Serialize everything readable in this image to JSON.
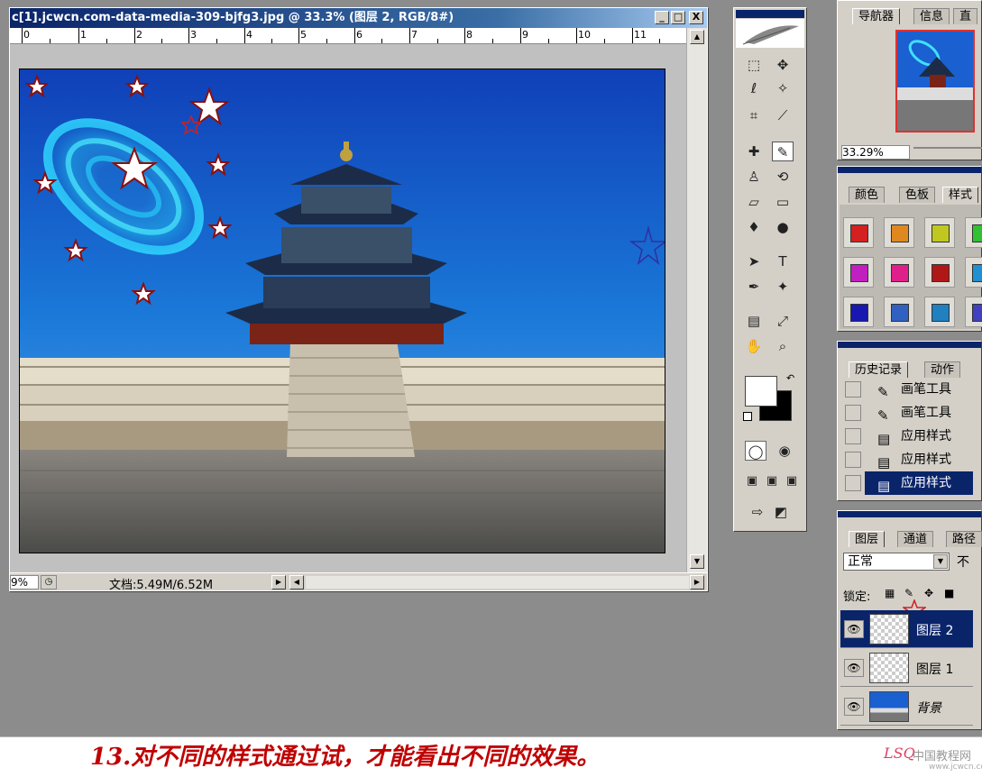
{
  "window": {
    "title": "c[1].jcwcn.com-data-media-309-bjfg3.jpg @ 33.3% (图层 2, RGB/8#)",
    "btn_min": "_",
    "btn_max": "□",
    "btn_close": "X"
  },
  "ruler": {
    "labels": [
      "0",
      "1",
      "2",
      "3",
      "4",
      "5",
      "6",
      "7",
      "8",
      "9",
      "10",
      "11"
    ]
  },
  "status": {
    "zoom": "9%",
    "doc": "文档:5.49M/6.52M",
    "arrow": "▶"
  },
  "navigator": {
    "tabs": [
      "导航器",
      "信息",
      "直"
    ],
    "zoom": "33.29%"
  },
  "swatches": {
    "tabs": [
      "颜色",
      "色板",
      "样式"
    ],
    "colors": [
      "#d42020",
      "#e08820",
      "#c0c820",
      "#30c030",
      "#c020c0",
      "#e0208a",
      "#b01818",
      "#2090d0",
      "#1818b0",
      "#3060c0",
      "#2080c0",
      "#4040c0"
    ]
  },
  "history": {
    "tabs": [
      "历史记录",
      "动作"
    ],
    "items": [
      "画笔工具",
      "画笔工具",
      "应用样式",
      "应用样式",
      "应用样式"
    ],
    "icons": [
      "brush-icon",
      "brush-icon",
      "document-icon",
      "document-icon",
      "document-icon"
    ]
  },
  "layers": {
    "tabs": [
      "图层",
      "通道",
      "路径"
    ],
    "blend_mode": "正常",
    "opacity_label": "不",
    "lock_label": "锁定:",
    "items": [
      "图层 2",
      "图层 1",
      "背景"
    ]
  },
  "caption": "13.对不同的样式通过试，才能看出不同的效果。",
  "signature": "LSQ",
  "watermark": "中国教程网",
  "watermark_url": "www.jcwcn.com",
  "colors": {
    "title_bar": "#0a246a",
    "accent": "#c00000"
  }
}
